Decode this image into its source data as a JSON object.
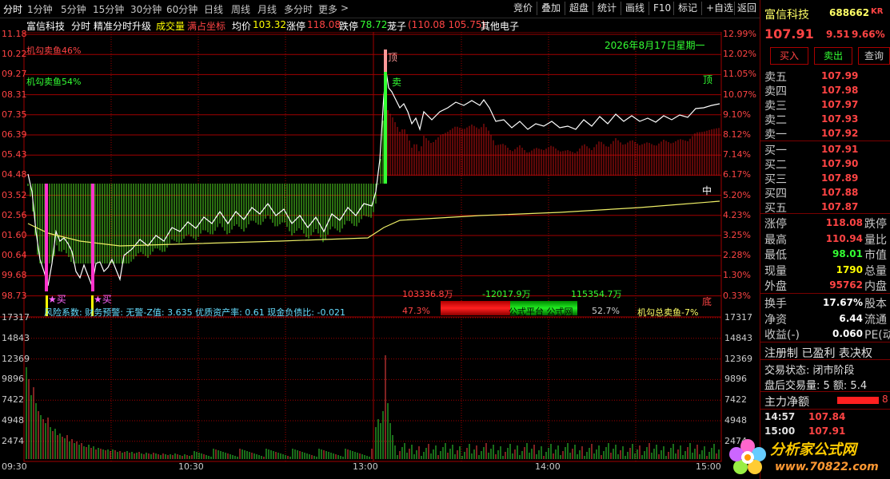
{
  "menu": {
    "tabs": [
      "分时",
      "1分钟",
      "5分钟",
      "15分钟",
      "30分钟",
      "60分钟",
      "日线",
      "周线",
      "月线",
      "多分时",
      "更多"
    ],
    "more_arrow": ">",
    "right_buttons": [
      "竞价",
      "叠加",
      "超盘",
      "统计",
      "画线",
      "F10",
      "标记",
      "+自选",
      "返回"
    ]
  },
  "info": {
    "stock": "富信科技",
    "mode": "分时",
    "indicator": "精准分时升级",
    "vol_label": "成交量",
    "coord_label": "满占坐标",
    "avg_label": "均价",
    "avg_value": "103.32",
    "limit_up_label": "涨停",
    "limit_up_value": "118.08",
    "limit_down_label": "跌停",
    "limit_down_value": "78.72",
    "dragon_label": "茏子",
    "dragon_values": "(110.08 105.75)",
    "sector": "其他电子"
  },
  "chart": {
    "date_text": "2026年8月17日星期一",
    "price_labels": [
      "11.18",
      "10.22",
      "09.27",
      "08.31",
      "07.35",
      "06.39",
      "05.43",
      "04.48",
      "03.52",
      "02.56",
      "01.60",
      "00.64",
      "99.68",
      "98.73"
    ],
    "pct_labels": [
      "12.99%",
      "12.02%",
      "11.05%",
      "10.07%",
      "9.10%",
      "8.12%",
      "7.14%",
      "6.17%",
      "5.20%",
      "4.23%",
      "3.25%",
      "2.28%",
      "1.30%",
      "0.33%"
    ],
    "vol_labels": [
      "17317",
      "14843",
      "12369",
      "9896",
      "7422",
      "4948",
      "2474"
    ],
    "time_labels": [
      "09:30",
      "10:30",
      "13:00",
      "14:00",
      "15:00"
    ],
    "label_sell_ratio": "机勾卖鱼46%",
    "label_sell_ratio2": "机勾卖鱼54%",
    "top_label_1": "顶",
    "top_label_2": "顶",
    "sell_label": "卖",
    "mid_label": "中",
    "bottom_label": "底",
    "buy_label_1": "买",
    "buy_label_2": "买",
    "flow_values": [
      "103336.8万",
      "-12017.9万",
      "115354.7万"
    ],
    "risk_text": "风险系数: 财务预警: 无警-Z值: 3.635 优质资产率: 0.61 现金负债比: -0.021",
    "pct_left": "47.3%",
    "bar_mid_text": "公式平台  公式网",
    "bar_pct": "52.7%",
    "bar_right_text": "机勾总卖鱼-7%",
    "watermark": "分析家公式网www.70822.com"
  },
  "chart_data": {
    "type": "line",
    "x": [
      "09:30",
      "10:30",
      "13:00",
      "14:00",
      "15:00"
    ],
    "ylabel": "",
    "ylim": [
      98.73,
      111.18
    ],
    "series": []
  },
  "panel": {
    "name": "富信科技",
    "code": "688662",
    "kr": "KR",
    "price": "107.91",
    "change": "9.51",
    "change_pct": "9.66%",
    "buy_btn": "买入",
    "sell_btn": "卖出",
    "query_btn": "查询",
    "asks": [
      {
        "label": "卖五",
        "price": "107.99"
      },
      {
        "label": "卖四",
        "price": "107.98"
      },
      {
        "label": "卖三",
        "price": "107.97"
      },
      {
        "label": "卖二",
        "price": "107.93"
      },
      {
        "label": "卖一",
        "price": "107.92"
      }
    ],
    "bids": [
      {
        "label": "买一",
        "price": "107.91"
      },
      {
        "label": "买二",
        "price": "107.90"
      },
      {
        "label": "买三",
        "price": "107.89"
      },
      {
        "label": "买四",
        "price": "107.88"
      },
      {
        "label": "买五",
        "price": "107.87"
      }
    ],
    "stats": [
      {
        "l1": "涨停",
        "v1": "118.08",
        "l2": "跌停",
        "c": "red"
      },
      {
        "l1": "最高",
        "v1": "110.94",
        "l2": "量比",
        "c": "red"
      },
      {
        "l1": "最低",
        "v1": "98.01",
        "l2": "市值",
        "c": "green"
      },
      {
        "l1": "现量",
        "v1": "1790",
        "l2": "总量",
        "c": "yellow"
      },
      {
        "l1": "外盘",
        "v1": "95762",
        "l2": "内盘",
        "c": "red"
      }
    ],
    "stats2": [
      {
        "l1": "换手",
        "v1": "17.67%",
        "l2": "股本"
      },
      {
        "l1": "净资",
        "v1": "6.44",
        "l2": "流通"
      },
      {
        "l1": "收益(-)",
        "v1": "0.060",
        "l2": "PE(动"
      }
    ],
    "tags": "注册制 已盈利 表决权",
    "trade_state": "交易状态: 闭市阶段",
    "after_hours": "盘后交易量: 5  额: 5.4",
    "main_flow": "主力净额",
    "main_flow_val": "8",
    "ticks": [
      {
        "t": "14:57",
        "p": "107.84"
      },
      {
        "t": "15:00",
        "p": "107.91"
      }
    ],
    "logo_text": "分析家公式网",
    "logo_url": "www.70822.com"
  }
}
